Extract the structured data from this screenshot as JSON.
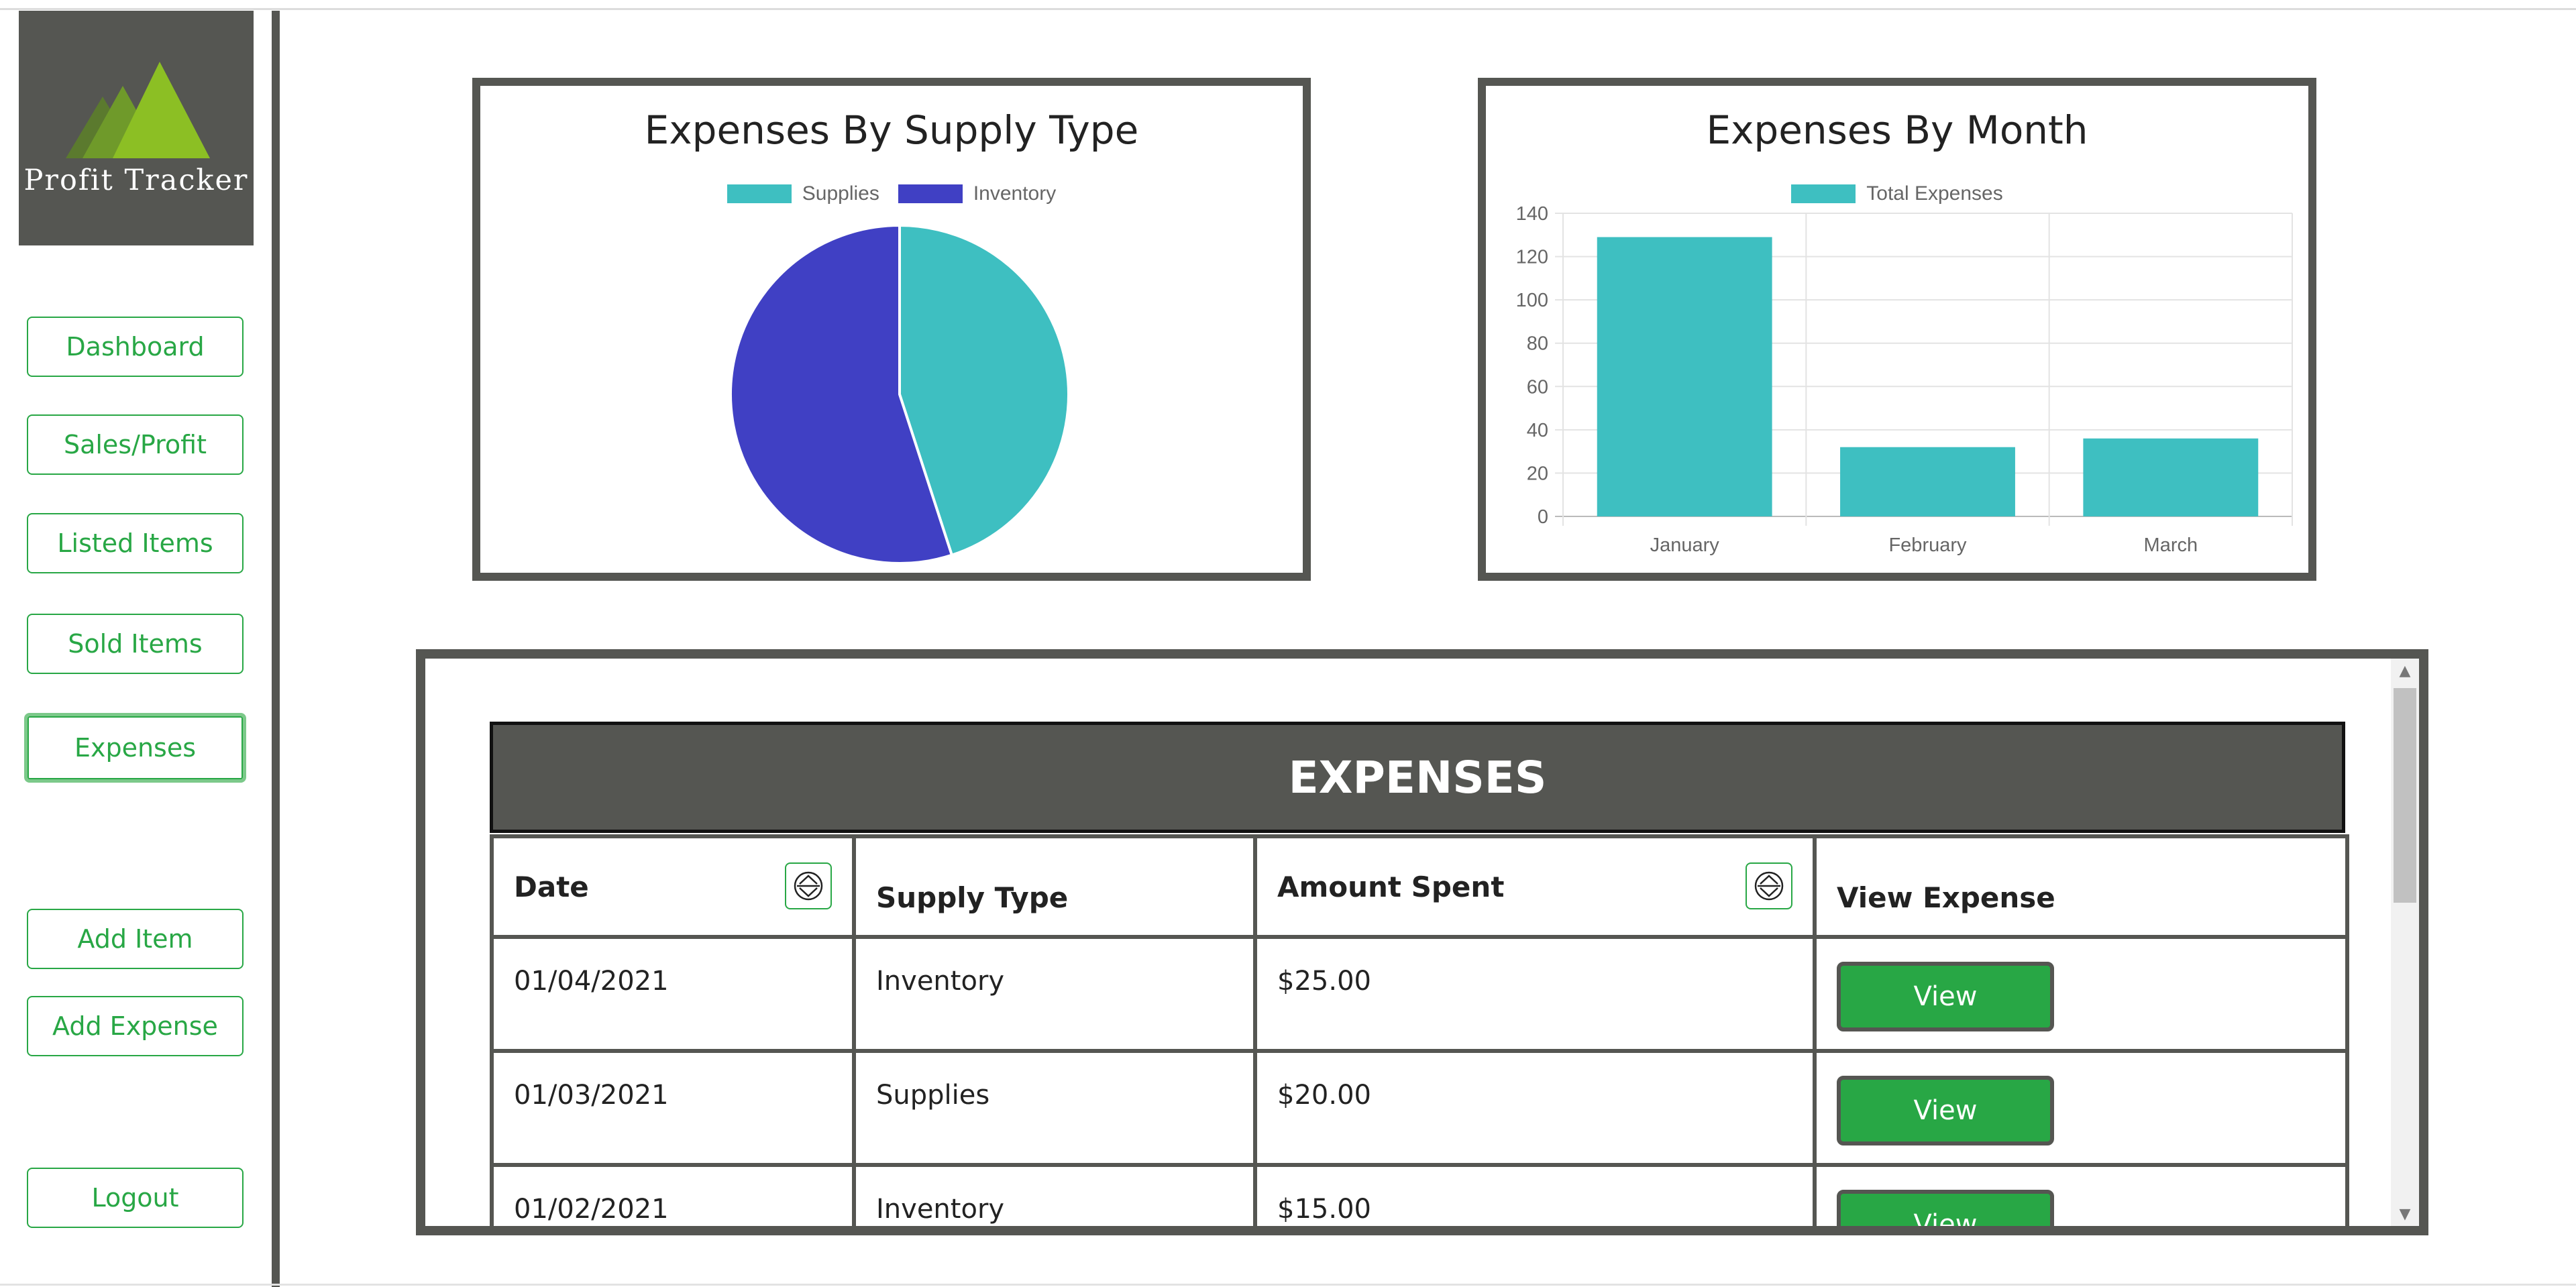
{
  "app": {
    "logo_text": "Profit Tracker"
  },
  "nav": {
    "dashboard": "Dashboard",
    "sales_profit": "Sales/Profit",
    "listed_items": "Listed Items",
    "sold_items": "Sold Items",
    "expenses": "Expenses",
    "add_item": "Add Item",
    "add_expense": "Add Expense",
    "logout": "Logout",
    "active": "expenses"
  },
  "colors": {
    "accent": "#28a745",
    "panel": "#555652",
    "teal": "#3ebfc1",
    "indigo": "#4040c4"
  },
  "pie_chart": {
    "title": "Expenses By Supply Type",
    "legend": [
      "Supplies",
      "Inventory"
    ]
  },
  "bar_chart": {
    "title": "Expenses By Month",
    "legend": [
      "Total Expenses"
    ],
    "y_ticks": [
      "140",
      "120",
      "100",
      "80",
      "60",
      "40",
      "20",
      "0"
    ],
    "x_ticks": [
      "January",
      "February",
      "March"
    ]
  },
  "chart_data": [
    {
      "type": "pie",
      "title": "Expenses By Supply Type",
      "categories": [
        "Supplies",
        "Inventory"
      ],
      "values": [
        45,
        55
      ],
      "colors": [
        "#3ebfc1",
        "#4040c4"
      ],
      "legend": "top"
    },
    {
      "type": "bar",
      "title": "Expenses By Month",
      "categories": [
        "January",
        "February",
        "March"
      ],
      "series": [
        {
          "name": "Total Expenses",
          "values": [
            129,
            32,
            36
          ]
        }
      ],
      "ylim": [
        0,
        140
      ],
      "color": "#3ebfc1",
      "grid": true,
      "legend": "top"
    }
  ],
  "table": {
    "title": "EXPENSES",
    "columns": [
      "Date",
      "Supply Type",
      "Amount Spent",
      "View Expense"
    ],
    "rows": [
      {
        "date": "01/04/2021",
        "supply_type": "Inventory",
        "amount": "$25.00",
        "action": "View"
      },
      {
        "date": "01/03/2021",
        "supply_type": "Supplies",
        "amount": "$20.00",
        "action": "View"
      },
      {
        "date": "01/02/2021",
        "supply_type": "Inventory",
        "amount": "$15.00",
        "action": "View"
      }
    ]
  }
}
